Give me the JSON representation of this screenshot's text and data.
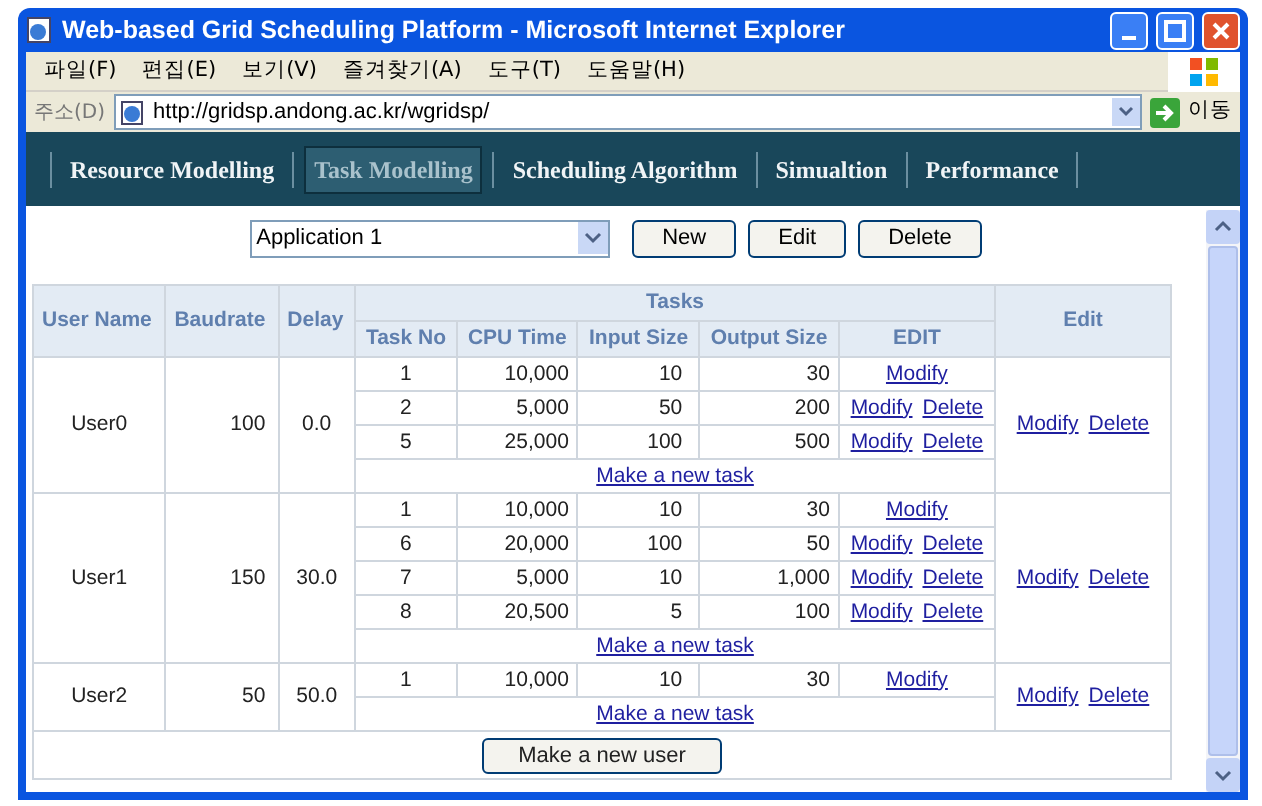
{
  "window": {
    "title": "Web-based Grid Scheduling Platform - Microsoft Internet Explorer"
  },
  "menu": [
    "파일(F)",
    "편집(E)",
    "보기(V)",
    "즐겨찾기(A)",
    "도구(T)",
    "도움말(H)"
  ],
  "address_bar": {
    "label": "주소(D)",
    "url": "http://gridsp.andong.ac.kr/wgridsp/",
    "go": "이동"
  },
  "nav": [
    {
      "label": "Resource Modelling",
      "selected": false
    },
    {
      "label": "Task Modelling",
      "selected": true
    },
    {
      "label": "Scheduling Algorithm",
      "selected": false
    },
    {
      "label": "Simualtion",
      "selected": false
    },
    {
      "label": "Performance",
      "selected": false
    }
  ],
  "toolbar": {
    "application": "Application 1",
    "buttons": [
      "New",
      "Edit",
      "Delete"
    ]
  },
  "table": {
    "columns": [
      "User Name",
      "Baudrate",
      "Delay"
    ],
    "tasks_heading": "Tasks",
    "task_columns": [
      "Task No",
      "CPU Time",
      "Input Size",
      "Output Size",
      "EDIT"
    ],
    "edit_heading": "Edit",
    "users": [
      {
        "name": "User0",
        "baudrate": "100",
        "delay": "0.0",
        "links": [
          "Modify",
          "Delete"
        ],
        "new_task": "Make a new task",
        "tasks": [
          {
            "no": "1",
            "cpu": "10,000",
            "input": "10",
            "output": "30",
            "links": [
              "Modify"
            ]
          },
          {
            "no": "2",
            "cpu": "5,000",
            "input": "50",
            "output": "200",
            "links": [
              "Modify",
              "Delete"
            ]
          },
          {
            "no": "5",
            "cpu": "25,000",
            "input": "100",
            "output": "500",
            "links": [
              "Modify",
              "Delete"
            ]
          }
        ]
      },
      {
        "name": "User1",
        "baudrate": "150",
        "delay": "30.0",
        "links": [
          "Modify",
          "Delete"
        ],
        "new_task": "Make a new task",
        "tasks": [
          {
            "no": "1",
            "cpu": "10,000",
            "input": "10",
            "output": "30",
            "links": [
              "Modify"
            ]
          },
          {
            "no": "6",
            "cpu": "20,000",
            "input": "100",
            "output": "50",
            "links": [
              "Modify",
              "Delete"
            ]
          },
          {
            "no": "7",
            "cpu": "5,000",
            "input": "10",
            "output": "1,000",
            "links": [
              "Modify",
              "Delete"
            ]
          },
          {
            "no": "8",
            "cpu": "20,500",
            "input": "5",
            "output": "100",
            "links": [
              "Modify",
              "Delete"
            ]
          }
        ]
      },
      {
        "name": "User2",
        "baudrate": "50",
        "delay": "50.0",
        "links": [
          "Modify",
          "Delete"
        ],
        "new_task": "Make a new task",
        "tasks": [
          {
            "no": "1",
            "cpu": "10,000",
            "input": "10",
            "output": "30",
            "links": [
              "Modify"
            ]
          }
        ]
      }
    ],
    "new_user": "Make a new user"
  }
}
